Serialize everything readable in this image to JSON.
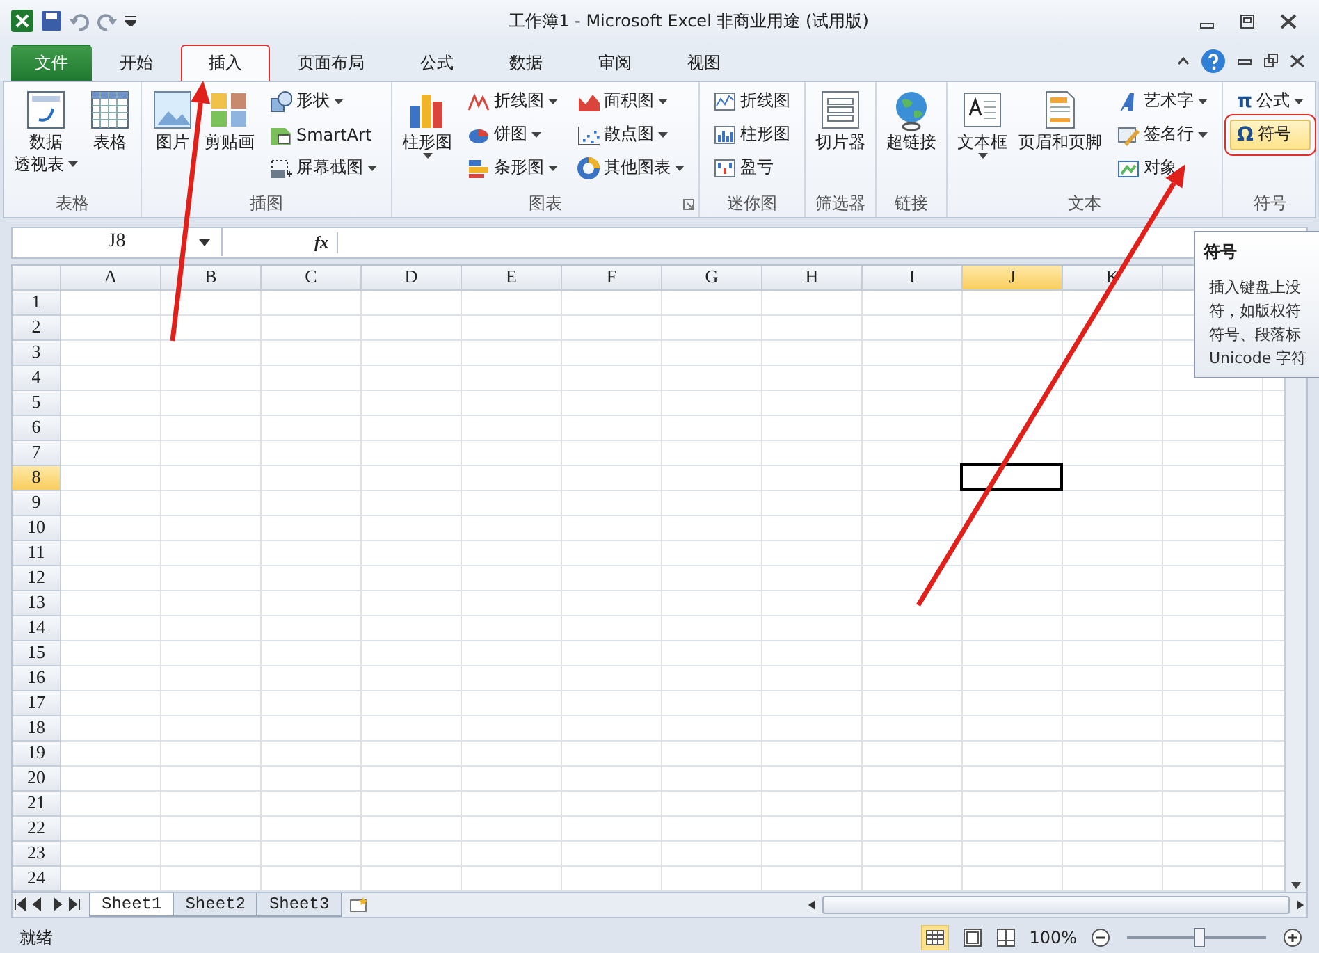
{
  "window": {
    "title": "工作簿1 - Microsoft Excel 非商业用途 (试用版)"
  },
  "tabs": [
    {
      "label": "文件",
      "kind": "file",
      "selected": false,
      "boxed": false
    },
    {
      "label": "开始",
      "kind": "tab",
      "selected": false,
      "boxed": false
    },
    {
      "label": "插入",
      "kind": "tab",
      "selected": true,
      "boxed": true
    },
    {
      "label": "页面布局",
      "kind": "tab",
      "selected": false,
      "boxed": false
    },
    {
      "label": "公式",
      "kind": "tab",
      "selected": false,
      "boxed": false
    },
    {
      "label": "数据",
      "kind": "tab",
      "selected": false,
      "boxed": false
    },
    {
      "label": "审阅",
      "kind": "tab",
      "selected": false,
      "boxed": false
    },
    {
      "label": "视图",
      "kind": "tab",
      "selected": false,
      "boxed": false
    }
  ],
  "ribbon": {
    "groups": [
      {
        "label": "表格",
        "launcher": false,
        "columns": [
          {
            "kind": "large",
            "lines": [
              "数据",
              "透视表"
            ],
            "dropdown": true
          },
          {
            "kind": "large",
            "lines": [
              "表格"
            ],
            "dropdown": false
          }
        ]
      },
      {
        "label": "插图",
        "launcher": false,
        "columns": [
          {
            "kind": "large",
            "lines": [
              "图片"
            ],
            "dropdown": false
          },
          {
            "kind": "large",
            "lines": [
              "剪贴画"
            ],
            "dropdown": false
          },
          {
            "kind": "stack",
            "items": [
              {
                "label": "形状",
                "dropdown": true,
                "hovered": false,
                "boxed": false
              },
              {
                "label": "SmartArt",
                "dropdown": false,
                "hovered": false,
                "boxed": false
              },
              {
                "label": "屏幕截图",
                "dropdown": true,
                "hovered": false,
                "boxed": false
              }
            ]
          }
        ]
      },
      {
        "label": "图表",
        "launcher": true,
        "columns": [
          {
            "kind": "large",
            "lines": [
              "柱形图"
            ],
            "dropdown": true
          },
          {
            "kind": "stack",
            "items": [
              {
                "label": "折线图",
                "dropdown": true,
                "hovered": false,
                "boxed": false
              },
              {
                "label": "饼图",
                "dropdown": true,
                "hovered": false,
                "boxed": false
              },
              {
                "label": "条形图",
                "dropdown": true,
                "hovered": false,
                "boxed": false
              }
            ]
          },
          {
            "kind": "stack",
            "items": [
              {
                "label": "面积图",
                "dropdown": true,
                "hovered": false,
                "boxed": false
              },
              {
                "label": "散点图",
                "dropdown": true,
                "hovered": false,
                "boxed": false
              },
              {
                "label": "其他图表",
                "dropdown": true,
                "hovered": false,
                "boxed": false
              }
            ]
          }
        ]
      },
      {
        "label": "迷你图",
        "launcher": false,
        "columns": [
          {
            "kind": "stack",
            "items": [
              {
                "label": "折线图",
                "dropdown": false,
                "hovered": false,
                "boxed": false
              },
              {
                "label": "柱形图",
                "dropdown": false,
                "hovered": false,
                "boxed": false
              },
              {
                "label": "盈亏",
                "dropdown": false,
                "hovered": false,
                "boxed": false
              }
            ]
          }
        ]
      },
      {
        "label": "筛选器",
        "launcher": false,
        "columns": [
          {
            "kind": "large",
            "lines": [
              "切片器"
            ],
            "dropdown": false
          }
        ]
      },
      {
        "label": "链接",
        "launcher": false,
        "columns": [
          {
            "kind": "large",
            "lines": [
              "超链接"
            ],
            "dropdown": false
          }
        ]
      },
      {
        "label": "文本",
        "launcher": false,
        "columns": [
          {
            "kind": "large",
            "lines": [
              "文本框"
            ],
            "dropdown": true
          },
          {
            "kind": "large",
            "lines": [
              "页眉和页脚"
            ],
            "dropdown": false
          },
          {
            "kind": "stack",
            "items": [
              {
                "label": "艺术字",
                "dropdown": true,
                "hovered": false,
                "boxed": false
              },
              {
                "label": "签名行",
                "dropdown": true,
                "hovered": false,
                "boxed": false
              },
              {
                "label": "对象",
                "dropdown": false,
                "hovered": false,
                "boxed": false
              }
            ]
          }
        ]
      },
      {
        "label": "符号",
        "launcher": false,
        "columns": [
          {
            "kind": "stack",
            "items": [
              {
                "label": "公式",
                "glyph": "π",
                "dropdown": true,
                "hovered": false,
                "boxed": false
              },
              {
                "label": "符号",
                "glyph": "Ω",
                "dropdown": false,
                "hovered": true,
                "boxed": true
              }
            ]
          }
        ]
      }
    ]
  },
  "formula_bar": {
    "name_box": "J8",
    "fx": "fx"
  },
  "tooltip": {
    "title": "符号",
    "lines": [
      "插入键盘上没",
      "符，如版权符",
      "符号、段落标",
      "Unicode 字符"
    ]
  },
  "grid": {
    "columns": [
      {
        "label": "A",
        "selected": false
      },
      {
        "label": "B",
        "selected": false
      },
      {
        "label": "C",
        "selected": false
      },
      {
        "label": "D",
        "selected": false
      },
      {
        "label": "E",
        "selected": false
      },
      {
        "label": "F",
        "selected": false
      },
      {
        "label": "G",
        "selected": false
      },
      {
        "label": "H",
        "selected": false
      },
      {
        "label": "I",
        "selected": false
      },
      {
        "label": "J",
        "selected": true
      },
      {
        "label": "K",
        "selected": false
      }
    ],
    "rows": [
      {
        "label": "1",
        "selected": false
      },
      {
        "label": "2",
        "selected": false
      },
      {
        "label": "3",
        "selected": false
      },
      {
        "label": "4",
        "selected": false
      },
      {
        "label": "5",
        "selected": false
      },
      {
        "label": "6",
        "selected": false
      },
      {
        "label": "7",
        "selected": false
      },
      {
        "label": "8",
        "selected": true
      },
      {
        "label": "9",
        "selected": false
      },
      {
        "label": "10",
        "selected": false
      },
      {
        "label": "11",
        "selected": false
      },
      {
        "label": "12",
        "selected": false
      },
      {
        "label": "13",
        "selected": false
      },
      {
        "label": "14",
        "selected": false
      },
      {
        "label": "15",
        "selected": false
      },
      {
        "label": "16",
        "selected": false
      },
      {
        "label": "17",
        "selected": false
      },
      {
        "label": "18",
        "selected": false
      },
      {
        "label": "19",
        "selected": false
      },
      {
        "label": "20",
        "selected": false
      },
      {
        "label": "21",
        "selected": false
      },
      {
        "label": "22",
        "selected": false
      },
      {
        "label": "23",
        "selected": false
      },
      {
        "label": "24",
        "selected": false
      }
    ]
  },
  "sheets": [
    {
      "label": "Sheet1",
      "selected": true
    },
    {
      "label": "Sheet2",
      "selected": false
    },
    {
      "label": "Sheet3",
      "selected": false
    }
  ],
  "status_bar": {
    "status": "就绪",
    "zoom": "100%",
    "zoom_level": {
      "level": 0.5
    }
  },
  "annotations": [
    {
      "kind": "arrow"
    },
    {
      "kind": "arrow"
    }
  ]
}
